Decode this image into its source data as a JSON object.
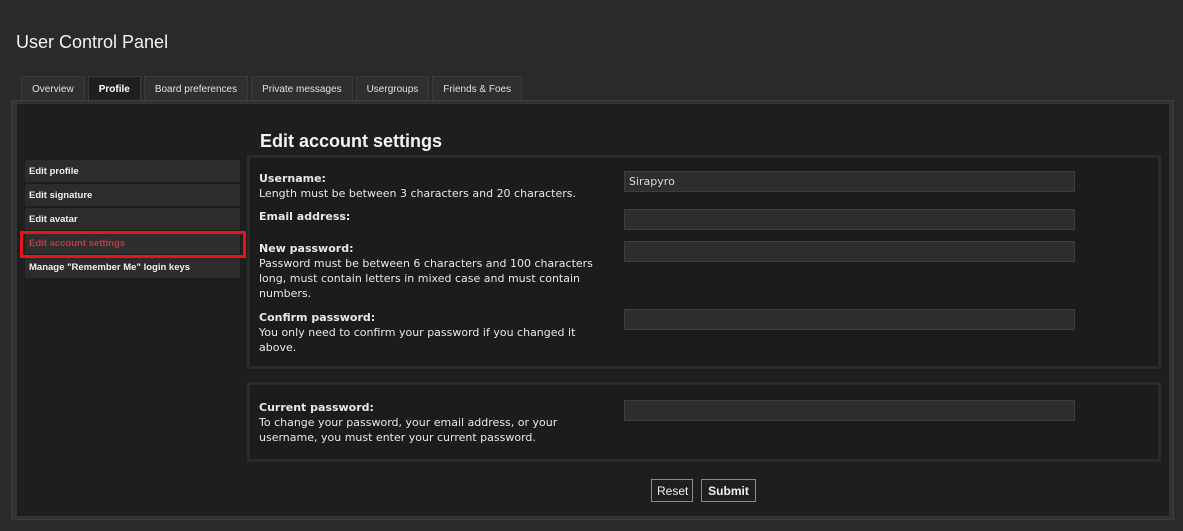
{
  "page": {
    "title": "User Control Panel"
  },
  "tabs": [
    {
      "label": "Overview"
    },
    {
      "label": "Profile",
      "active": true
    },
    {
      "label": "Board preferences"
    },
    {
      "label": "Private messages"
    },
    {
      "label": "Usergroups"
    },
    {
      "label": "Friends & Foes"
    }
  ],
  "sidebar": {
    "items": [
      {
        "label": "Edit profile"
      },
      {
        "label": "Edit signature"
      },
      {
        "label": "Edit avatar"
      },
      {
        "label": "Edit account settings",
        "active": true
      },
      {
        "label": "Manage \"Remember Me\" login keys"
      }
    ]
  },
  "content": {
    "title": "Edit account settings",
    "fields": {
      "username": {
        "label": "Username:",
        "hint": "Length must be between 3 characters and 20 characters.",
        "value": "Sirapyro"
      },
      "email": {
        "label": "Email address:",
        "value": ""
      },
      "new_password": {
        "label": "New password:",
        "hint": "Password must be between 6 characters and 100 characters long, must contain letters in mixed case and must contain numbers.",
        "value": ""
      },
      "confirm_password": {
        "label": "Confirm password:",
        "hint": "You only need to confirm your password if you changed it above.",
        "value": ""
      },
      "current_password": {
        "label": "Current password:",
        "hint": "To change your password, your email address, or your username, you must enter your current password.",
        "value": ""
      }
    }
  },
  "buttons": {
    "reset": "Reset",
    "submit": "Submit"
  },
  "colors": {
    "active_menu": "#c23a3a",
    "highlight": "#e8141c",
    "background": "#2a2a2a"
  }
}
